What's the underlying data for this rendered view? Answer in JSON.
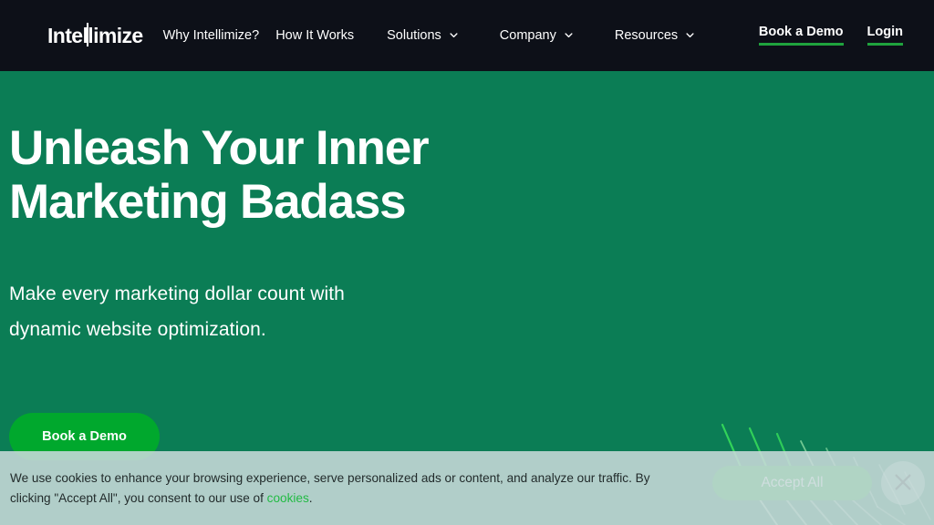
{
  "header": {
    "logo_text_pre": "Inte",
    "logo_text_tall": "ll",
    "logo_text_post": "imize",
    "logo_full": "Intellimize",
    "nav_simple": [
      {
        "label": "Why Intellimize?"
      },
      {
        "label": "How It Works"
      }
    ],
    "nav_dropdowns": [
      {
        "label": "Solutions",
        "icon": "chevron-down-icon"
      },
      {
        "label": "Company",
        "icon": "chevron-down-icon"
      },
      {
        "label": "Resources",
        "icon": "chevron-down-icon"
      }
    ],
    "book_demo_label": "Book a Demo",
    "login_label": "Login",
    "bg_color": "#0d1018",
    "underline_color": "#1fa33d"
  },
  "hero": {
    "title_line1": "Unleash Your Inner",
    "title_line2": "Marketing Badass",
    "subtitle_line1": "Make every marketing dollar count with",
    "subtitle_line2": "dynamic website optimization.",
    "cta_label": "Book a Demo",
    "bg_color": "#0b7d55",
    "cta_color": "#00a82d",
    "text_color": "#ffffff"
  },
  "cookie_banner": {
    "text_part1": "We use cookies to enhance your browsing experience, serve personalized ads or content, and analyze our traffic. By clicking \"Accept All\", you consent to our use of ",
    "link_label": "cookies",
    "text_part2": ".",
    "accept_label": "Accept All",
    "close_icon": "close-icon",
    "bg_color": "#c8dada",
    "accept_color": "#00a82d",
    "link_color": "#22bb44"
  }
}
